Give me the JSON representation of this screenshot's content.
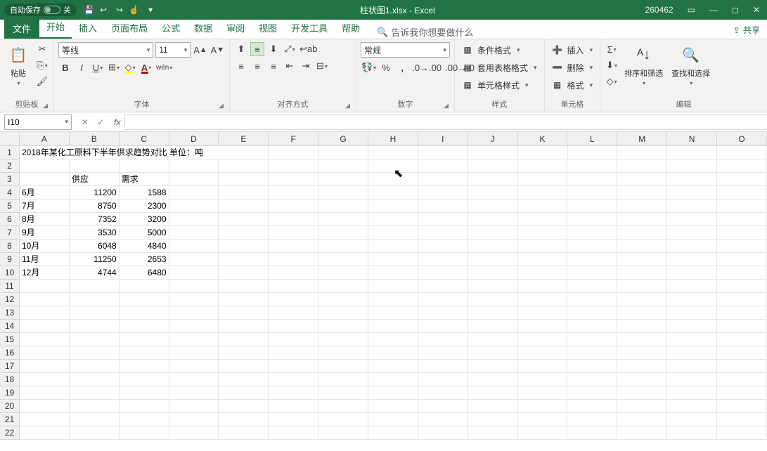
{
  "titlebar": {
    "autosave_label": "自动保存",
    "autosave_state": "关",
    "filename": "柱状图1.xlsx  -  Excel",
    "account": "260462"
  },
  "tabs": {
    "file": "文件",
    "items": [
      "开始",
      "插入",
      "页面布局",
      "公式",
      "数据",
      "审阅",
      "视图",
      "开发工具",
      "帮助"
    ],
    "active_index": 0,
    "tellme_placeholder": "告诉我你想要做什么",
    "share": "共享"
  },
  "ribbon": {
    "clipboard": {
      "paste": "粘贴",
      "label": "剪贴板"
    },
    "font": {
      "name": "等线",
      "size": "11",
      "label": "字体"
    },
    "align": {
      "wrap": "",
      "merge": "",
      "label": "对齐方式"
    },
    "number": {
      "format": "常规",
      "label": "数字"
    },
    "styles": {
      "cond": "条件格式",
      "table": "套用表格格式",
      "cell": "单元格样式",
      "label": "样式"
    },
    "cells": {
      "insert": "插入",
      "delete": "删除",
      "format": "格式",
      "label": "单元格"
    },
    "editing": {
      "sort": "排序和筛选",
      "find": "查找和选择",
      "label": "编辑"
    }
  },
  "formula_bar": {
    "namebox": "I10",
    "formula": ""
  },
  "sheet": {
    "columns": [
      "A",
      "B",
      "C",
      "D",
      "E",
      "F",
      "G",
      "H",
      "I",
      "J",
      "K",
      "L",
      "M",
      "N",
      "O"
    ],
    "row_count": 22,
    "title_cell": "2018年某化工原料下半年供求趋势对比 单位：吨",
    "headers": {
      "b": "供应",
      "c": "需求"
    },
    "data": [
      {
        "m": "6月",
        "s": "11200",
        "d": "1588"
      },
      {
        "m": "7月",
        "s": "8750",
        "d": "2300"
      },
      {
        "m": "8月",
        "s": "7352",
        "d": "3200"
      },
      {
        "m": "9月",
        "s": "3530",
        "d": "5000"
      },
      {
        "m": "10月",
        "s": "6048",
        "d": "4840"
      },
      {
        "m": "11月",
        "s": "11250",
        "d": "2653"
      },
      {
        "m": "12月",
        "s": "4744",
        "d": "6480"
      }
    ]
  },
  "chart_data": {
    "type": "table",
    "title": "2018年某化工原料下半年供求趋势对比 单位：吨",
    "categories": [
      "6月",
      "7月",
      "8月",
      "9月",
      "10月",
      "11月",
      "12月"
    ],
    "series": [
      {
        "name": "供应",
        "values": [
          11200,
          8750,
          7352,
          3530,
          6048,
          11250,
          4744
        ]
      },
      {
        "name": "需求",
        "values": [
          1588,
          2300,
          3200,
          5000,
          4840,
          2653,
          6480
        ]
      }
    ]
  }
}
